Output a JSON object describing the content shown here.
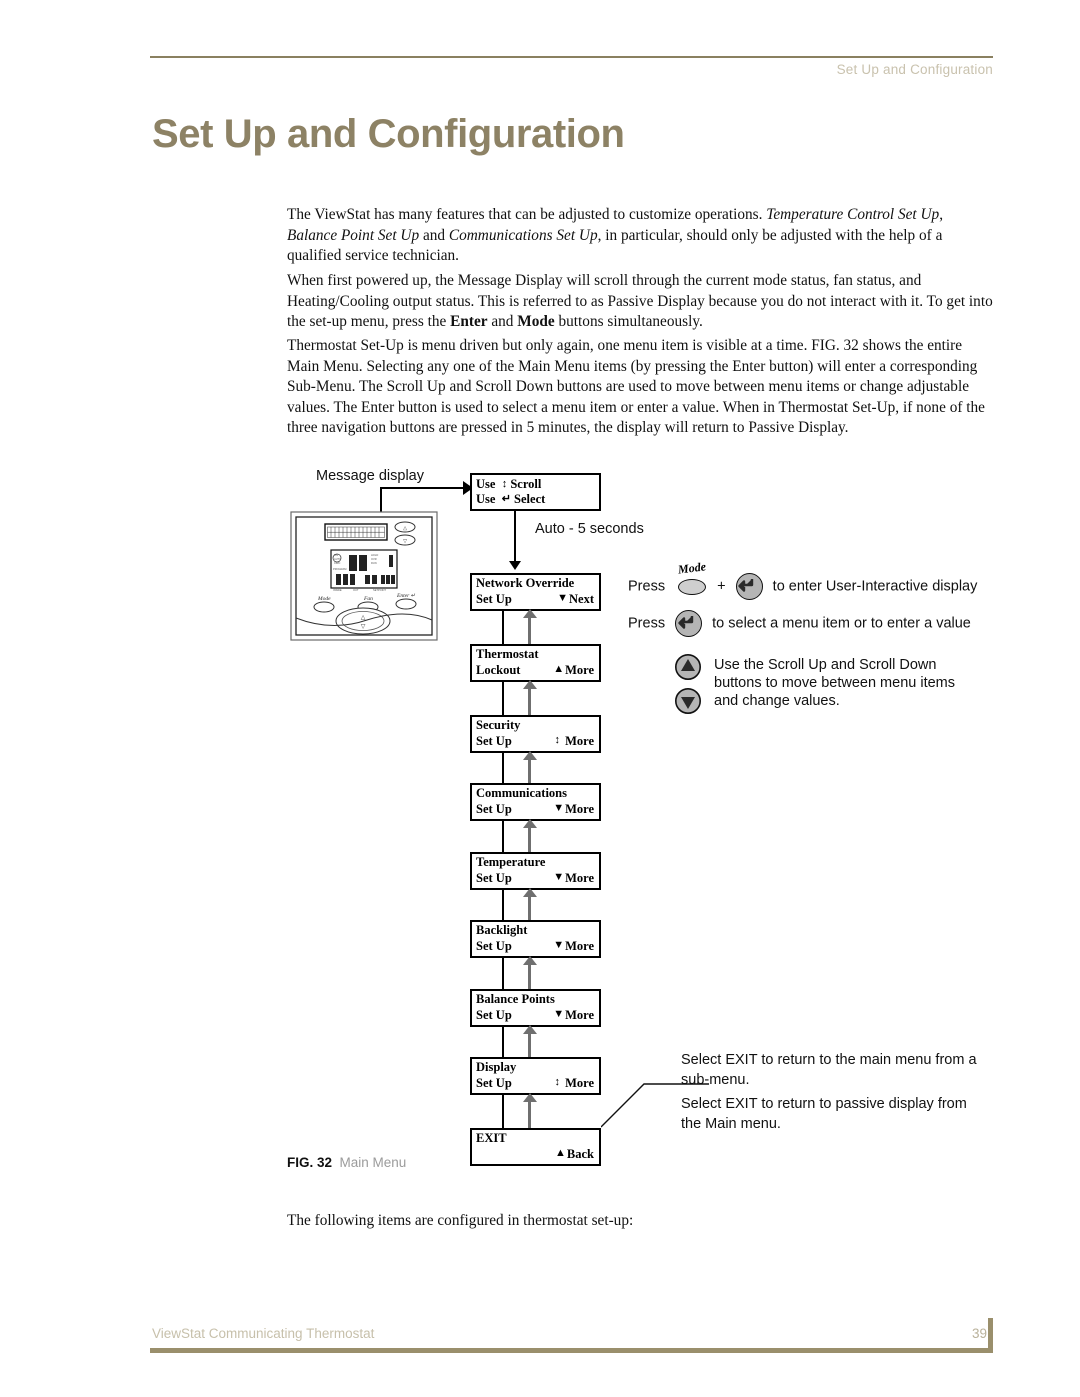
{
  "header": {
    "running_head": "Set Up and Configuration",
    "title": "Set Up and Configuration"
  },
  "body": {
    "p1_a": "The ViewStat has many features that can be adjusted to customize operations. ",
    "p1_i1": "Temperature Control Set Up",
    "p1_b": ", ",
    "p1_i2": "Balance Point Set Up",
    "p1_c": " and ",
    "p1_i3": "Communications Set Up",
    "p1_d": ", in particular, should only be adjusted with the help of a qualified service technician.",
    "p2_a": "When first powered up, the Message Display will scroll through the current mode status, fan status, and Heating/Cooling output status. This is referred to as Passive Display because you do not interact with it. To get into the set-up menu, press the ",
    "p2_b1": "Enter",
    "p2_b": " and ",
    "p2_b2": "Mode",
    "p2_c": " buttons simultaneously.",
    "p3": "Thermostat Set-Up is menu driven but only again, one menu item is visible at a time. FIG. 32 shows the entire Main Menu. Selecting any one of the Main Menu items (by pressing the Enter button) will enter a corresponding Sub-Menu. The Scroll Up and Scroll Down buttons are used to move between menu items or change adjustable values. The Enter button is used to select a menu item or enter a value. When in Thermostat Set-Up, if none of the three navigation buttons are pressed in 5 minutes, the display will return to Passive Display.",
    "p_after_fig": "The following items are configured in thermostat set-up:"
  },
  "figure": {
    "caption_label": "FIG. 32",
    "caption_text": "Main Menu",
    "message_display_label": "Message display",
    "auto_label": "Auto - 5 seconds",
    "prompt_box": {
      "line1_pre": "Use",
      "line1_glyph": "↕",
      "line1_post": "Scroll",
      "line2_pre": "Use",
      "line2_glyph": "↵",
      "line2_post": "Select"
    },
    "menu_items": [
      {
        "line1": "Network Override",
        "line2": "Set Up",
        "glyph": "▼",
        "action": "Next"
      },
      {
        "line1": "Thermostat",
        "line2": "Lockout",
        "glyph": "▲",
        "action": "More"
      },
      {
        "line1": "Security",
        "line2": "Set Up",
        "glyph": "↕",
        "action": "More"
      },
      {
        "line1": "Communications",
        "line2": "Set Up",
        "glyph": "▼",
        "action": "More"
      },
      {
        "line1": "Temperature",
        "line2": "Set Up",
        "glyph": "▼",
        "action": "More"
      },
      {
        "line1": "Backlight",
        "line2": "Set Up",
        "glyph": "▼",
        "action": "More"
      },
      {
        "line1": "Balance Points",
        "line2": "Set Up",
        "glyph": "▼",
        "action": "More"
      },
      {
        "line1": "Display",
        "line2": "Set Up",
        "glyph": "↕",
        "action": "More"
      },
      {
        "line1": "EXIT",
        "line2": "",
        "glyph": "▲",
        "action": "Back"
      }
    ],
    "legend": {
      "press1_pre": "Press",
      "mode_label": "Mode",
      "plus": "+",
      "press1_post": "to enter User-Interactive display",
      "press2_pre": "Press",
      "press2_post": "to select a menu item or to enter a value",
      "scroll_note_l1": "Use the Scroll Up and Scroll Down",
      "scroll_note_l2": "buttons to move between menu items",
      "scroll_note_l3": "and change values."
    },
    "exit_notes": {
      "n1_l1": "Select EXIT to return to the main menu from a",
      "n1_l2": "sub-menu.",
      "n2_l1": "Select EXIT to return to passive display from",
      "n2_l2": "the Main menu."
    },
    "thermostat_buttons": {
      "mode": "Mode",
      "fan": "Fan",
      "enter": "Enter"
    }
  },
  "footer": {
    "left": "ViewStat Communicating Thermostat",
    "page_number": "39"
  },
  "colors": {
    "title": "#8d8265",
    "rule": "#8a8060",
    "running_head": "#c9c2ae",
    "footer_bar": "#9a8f6c"
  }
}
